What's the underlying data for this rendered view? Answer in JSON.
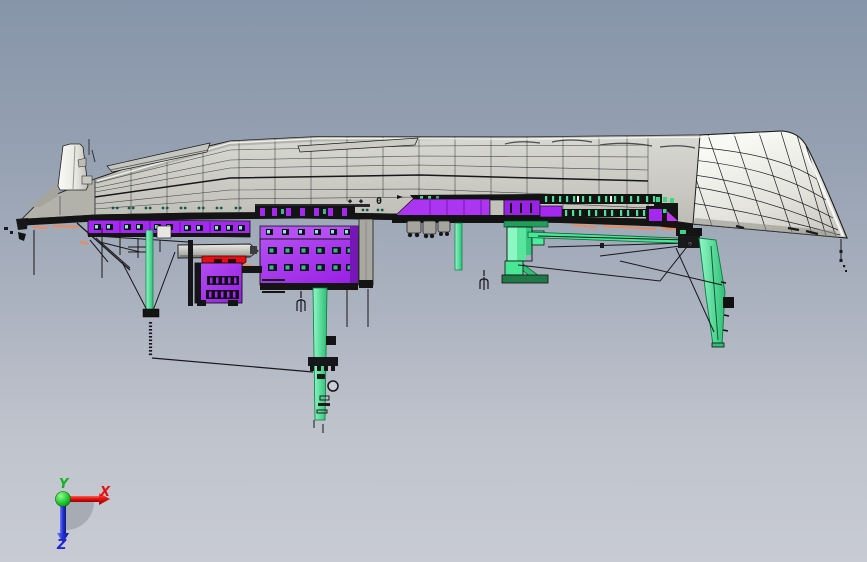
{
  "app": {
    "name": "cad-viewer-viewport"
  },
  "viewport": {
    "background_gradient_top": "#8795AA",
    "background_gradient_bottom": "#C8CBD3",
    "deck_marking": "0"
  },
  "triad": {
    "x_label": "X",
    "y_label": "Y",
    "z_label": "Z",
    "x_color": "#E31212",
    "y_color": "#12B31F",
    "z_color": "#2026D8"
  },
  "model": {
    "description": "inverted gray ship hull seen from below-side with purple deckhouse blocks, green cranes, rigging cables and a red carriage",
    "colors": {
      "hull_gray": "#CFCFC8",
      "hull_highlight": "#F6F6F2",
      "underside_black": "#141414",
      "accent_orange": "#EE8A58",
      "deckhouse_purple": "#A428F0",
      "window_teal": "#3FB393",
      "crane_green": "#4FEE9E",
      "carriage_red": "#DE1212",
      "wireframe_black": "#1A1A1A"
    },
    "parts": [
      {
        "name": "hull-deck",
        "color": "#CFCFC8"
      },
      {
        "name": "bow-funnel-tower",
        "color": "#F2F2EE"
      },
      {
        "name": "deckhouse-beam",
        "color": "#A428F0"
      },
      {
        "name": "deckhouse-block-a",
        "color": "#A428F0"
      },
      {
        "name": "deckhouse-block-b",
        "color": "#A428F0"
      },
      {
        "name": "midship-deckhouse",
        "color": "#AB35F0"
      },
      {
        "name": "gray-boom",
        "color": "#D8D8D2"
      },
      {
        "name": "red-carriage",
        "color": "#DE1212"
      },
      {
        "name": "forward-mast",
        "color": "#4FEE9E"
      },
      {
        "name": "center-derrick-column",
        "color": "#4FEE9E"
      },
      {
        "name": "midship-crane-pedestal",
        "color": "#3BD584"
      },
      {
        "name": "aft-crane-leg",
        "color": "#4FEE9E"
      },
      {
        "name": "rigging-cables",
        "color": "#1A1A1A"
      }
    ]
  }
}
